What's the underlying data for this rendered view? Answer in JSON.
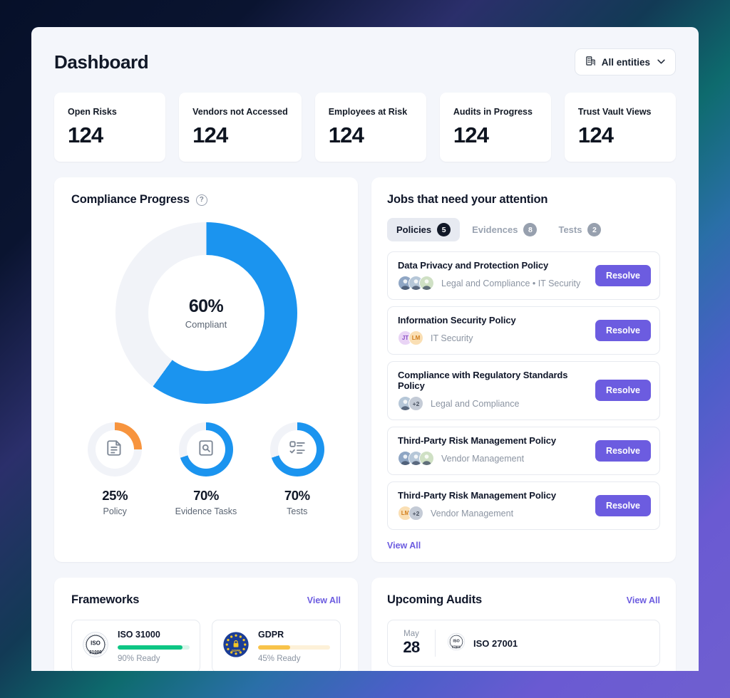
{
  "header": {
    "title": "Dashboard",
    "entity_selector": {
      "label": "All entities",
      "icon": "building-icon",
      "caret": "chevron-down-icon"
    }
  },
  "kpis": [
    {
      "label": "Open Risks",
      "value": "124"
    },
    {
      "label": "Vendors not Accessed",
      "value": "124"
    },
    {
      "label": "Employees at Risk",
      "value": "124"
    },
    {
      "label": "Audits in Progress",
      "value": "124"
    },
    {
      "label": "Trust Vault Views",
      "value": "124"
    }
  ],
  "compliance": {
    "title": "Compliance Progress",
    "help_icon": "?",
    "chart_data": {
      "type": "pie",
      "title": "Compliance Progress",
      "center_value": "60%",
      "center_label": "Compliant",
      "percent": 60,
      "track_color": "#f1f3f8",
      "fill_color": "#1b94ef",
      "gauges": [
        {
          "percent_label": "25%",
          "percent": 25,
          "label": "Policy",
          "color": "#f7943e",
          "icon": "document-lines-icon"
        },
        {
          "percent_label": "70%",
          "percent": 70,
          "label": "Evidence Tasks",
          "color": "#1b94ef",
          "icon": "document-search-icon"
        },
        {
          "percent_label": "70%",
          "percent": 70,
          "label": "Tests",
          "color": "#1b94ef",
          "icon": "checklist-icon"
        }
      ]
    }
  },
  "jobs": {
    "title": "Jobs that need your attention",
    "tabs": [
      {
        "label": "Policies",
        "count": "5",
        "active": true
      },
      {
        "label": "Evidences",
        "count": "8",
        "active": false
      },
      {
        "label": "Tests",
        "count": "2",
        "active": false
      }
    ],
    "rows": [
      {
        "title": "Data Privacy and Protection Policy",
        "dept": "Legal and Compliance • IT Security",
        "action": "Resolve",
        "avatars": [
          {
            "type": "photo",
            "tone": "#8fa6c4"
          },
          {
            "type": "photo",
            "tone": "#b6c7d8"
          },
          {
            "type": "photo",
            "tone": "#cfe0c4"
          }
        ]
      },
      {
        "title": "Information Security Policy",
        "dept": "IT Security",
        "action": "Resolve",
        "avatars": [
          {
            "type": "initials",
            "text": "JT",
            "bg": "#e9d4f5",
            "fg": "#8a4fc4"
          },
          {
            "type": "initials",
            "text": "LM",
            "bg": "#fadfb4",
            "fg": "#d07d1c"
          }
        ]
      },
      {
        "title": "Compliance with Regulatory Standards Policy",
        "dept": "Legal and Compliance",
        "action": "Resolve",
        "avatars": [
          {
            "type": "photo",
            "tone": "#b6c7d8"
          },
          {
            "type": "more",
            "text": "+2"
          }
        ]
      },
      {
        "title": "Third-Party Risk Management Policy",
        "dept": "Vendor Management",
        "action": "Resolve",
        "avatars": [
          {
            "type": "photo",
            "tone": "#8fa6c4"
          },
          {
            "type": "photo",
            "tone": "#b6c7d8"
          },
          {
            "type": "photo",
            "tone": "#cfe0c4"
          }
        ]
      },
      {
        "title": "Third-Party Risk Management Policy",
        "dept": "Vendor Management",
        "action": "Resolve",
        "avatars": [
          {
            "type": "initials",
            "text": "LM",
            "bg": "#fadfb4",
            "fg": "#d07d1c"
          },
          {
            "type": "more",
            "text": "+2"
          }
        ]
      }
    ],
    "view_all": "View All"
  },
  "frameworks": {
    "title": "Frameworks",
    "view_all": "View All",
    "items": [
      {
        "name": "ISO 31000",
        "ready": "90% Ready",
        "percent": 90,
        "bar_color": "#0ec684",
        "bar_track": "#d8f5ea",
        "badge": "iso-31000-badge",
        "badge_top": "ISO",
        "badge_bottom": "31000"
      },
      {
        "name": "GDPR",
        "ready": "45% Ready",
        "percent": 45,
        "bar_color": "#f8c34a",
        "bar_track": "#fdf1d8",
        "badge": "gdpr-badge",
        "badge_top": "GDPR",
        "badge_bottom": ""
      }
    ]
  },
  "audits": {
    "title": "Upcoming Audits",
    "view_all": "View All",
    "items": [
      {
        "month": "May",
        "day": "28",
        "framework": "ISO 27001",
        "badge": "iso-27001-badge"
      }
    ]
  }
}
